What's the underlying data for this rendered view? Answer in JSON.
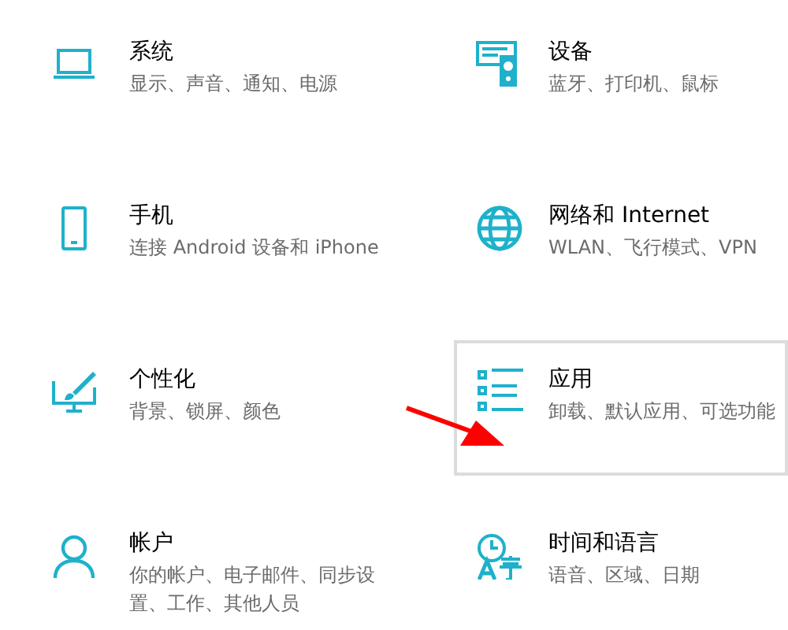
{
  "categories": [
    {
      "title": "系统",
      "description": "显示、声音、通知、电源",
      "highlighted": false
    },
    {
      "title": "设备",
      "description": "蓝牙、打印机、鼠标",
      "highlighted": false
    },
    {
      "title": "手机",
      "description": "连接 Android 设备和 iPhone",
      "highlighted": false
    },
    {
      "title": "网络和 Internet",
      "description": "WLAN、飞行模式、VPN",
      "highlighted": false
    },
    {
      "title": "个性化",
      "description": "背景、锁屏、颜色",
      "highlighted": false
    },
    {
      "title": "应用",
      "description": "卸载、默认应用、可选功能",
      "highlighted": true
    },
    {
      "title": "帐户",
      "description": "你的帐户、电子邮件、同步设置、工作、其他人员",
      "highlighted": false
    },
    {
      "title": "时间和语言",
      "description": "语音、区域、日期",
      "highlighted": false
    }
  ]
}
